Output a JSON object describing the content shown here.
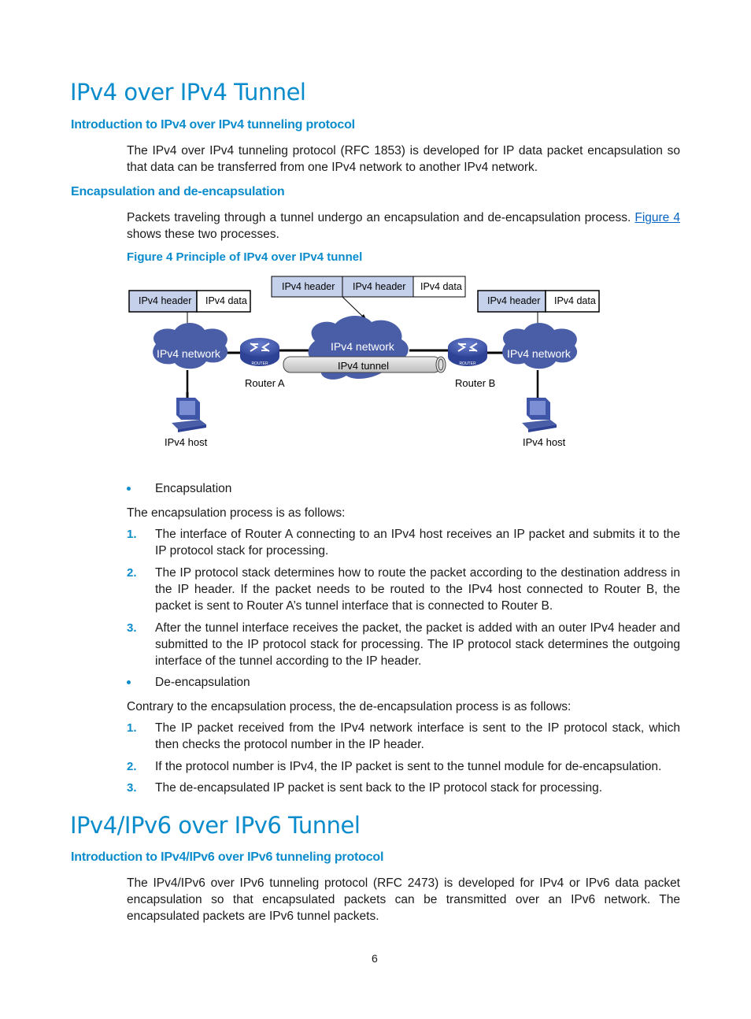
{
  "section1": {
    "title": "IPv4 over IPv4 Tunnel",
    "intro_heading": "Introduction to IPv4 over IPv4 tunneling protocol",
    "intro_paragraph": "The IPv4 over IPv4 tunneling protocol (RFC 1853) is developed for IP data packet encapsulation so that data can be transferred from one IPv4 network to another IPv4 network.",
    "encap_heading": "Encapsulation and de-encapsulation",
    "encap_paragraph_before_link": "Packets traveling through a tunnel undergo an encapsulation and de-encapsulation process. ",
    "encap_link": "Figure 4",
    "encap_paragraph_after_link": " shows these two processes.",
    "figure_caption": "Figure 4 Principle of IPv4 over IPv4 tunnel"
  },
  "figure": {
    "left_packet": {
      "header": "IPv4 header",
      "data": "IPv4 data"
    },
    "middle_packet": {
      "outer_header": "IPv4 header",
      "inner_header": "IPv4 header",
      "data": "IPv4 data"
    },
    "right_packet": {
      "header": "IPv4 header",
      "data": "IPv4 data"
    },
    "left_network": "IPv4 network",
    "middle_network": "IPv4 network",
    "right_network": "IPv4 network",
    "tunnel_label": "IPv4 tunnel",
    "router_a": "Router A",
    "router_b": "Router B",
    "router_badge": "ROUTER",
    "left_host": "IPv4 host",
    "right_host": "IPv4 host",
    "colors": {
      "cloud": "#4a5ea8",
      "header_fill": "#c5d1ea",
      "tunnel_fill": "#d4d4d4",
      "router": "#3f55a8"
    }
  },
  "encapsulation": {
    "bullet": "Encapsulation",
    "lead": "The encapsulation process is as follows:",
    "steps": [
      {
        "num": "1.",
        "text": "The interface of Router A connecting to an IPv4 host receives an IP packet and submits it to the IP protocol stack for processing."
      },
      {
        "num": "2.",
        "text": "The IP protocol stack determines how to route the packet according to the destination address in the IP header. If the packet needs to be routed to the IPv4 host connected to Router B, the packet is sent to Router A’s tunnel interface that is connected to Router B."
      },
      {
        "num": "3.",
        "text": "After the tunnel interface receives the packet, the packet is added with an outer IPv4 header and submitted to the IP protocol stack for processing. The IP protocol stack determines the outgoing interface of the tunnel according to the IP header."
      }
    ]
  },
  "deencapsulation": {
    "bullet": "De-encapsulation",
    "lead": "Contrary to the encapsulation process, the de-encapsulation process is as follows:",
    "steps": [
      {
        "num": "1.",
        "text": "The IP packet received from the IPv4 network interface is sent to the IP protocol stack, which then checks the protocol number in the IP header."
      },
      {
        "num": "2.",
        "text": "If the protocol number is IPv4, the IP packet is sent to the tunnel module for de-encapsulation."
      },
      {
        "num": "3.",
        "text": "The de-encapsulated IP packet is sent back to the IP protocol stack for processing."
      }
    ]
  },
  "section2": {
    "title": "IPv4/IPv6 over IPv6 Tunnel",
    "intro_heading": "Introduction to IPv4/IPv6 over IPv6 tunneling protocol",
    "intro_paragraph": "The IPv4/IPv6 over IPv6 tunneling protocol (RFC 2473) is developed for IPv4 or IPv6 data packet encapsulation so that encapsulated packets can be transmitted over an IPv6 network. The encapsulated packets are IPv6 tunnel packets."
  },
  "footer": {
    "page_number": "6"
  }
}
